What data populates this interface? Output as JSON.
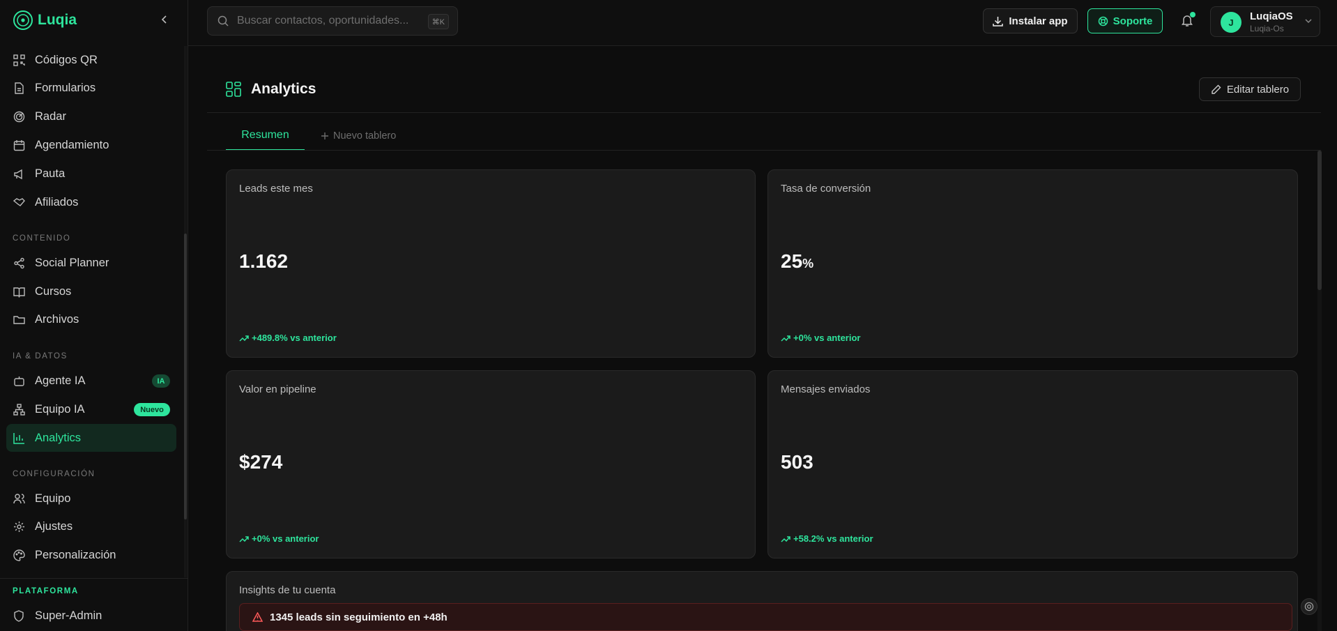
{
  "brand": {
    "name": "Luqia",
    "accent": "#2ee59d"
  },
  "sidebar": {
    "items_top": [
      {
        "label": "Códigos QR",
        "icon": "qr-icon"
      },
      {
        "label": "Formularios",
        "icon": "document-icon"
      },
      {
        "label": "Radar",
        "icon": "radar-icon"
      },
      {
        "label": "Agendamiento",
        "icon": "calendar-icon"
      },
      {
        "label": "Pauta",
        "icon": "megaphone-icon"
      },
      {
        "label": "Afiliados",
        "icon": "handshake-icon"
      }
    ],
    "sections": {
      "contenido": "CONTENIDO",
      "ia_datos": "IA & DATOS",
      "configuracion": "CONFIGURACIÓN",
      "plataforma": "PLATAFORMA"
    },
    "items_contenido": [
      {
        "label": "Social Planner",
        "icon": "share-icon"
      },
      {
        "label": "Cursos",
        "icon": "book-icon"
      },
      {
        "label": "Archivos",
        "icon": "folder-icon"
      }
    ],
    "items_ia": [
      {
        "label": "Agente IA",
        "icon": "bot-icon",
        "badge": "IA"
      },
      {
        "label": "Equipo IA",
        "icon": "network-icon",
        "badge": "Nuevo"
      },
      {
        "label": "Analytics",
        "icon": "bar-chart-icon",
        "active": true
      }
    ],
    "items_config": [
      {
        "label": "Equipo",
        "icon": "users-icon"
      },
      {
        "label": "Ajustes",
        "icon": "gear-icon"
      },
      {
        "label": "Personalización",
        "icon": "palette-icon"
      }
    ],
    "items_plataforma": [
      {
        "label": "Super-Admin",
        "icon": "shield-icon"
      }
    ]
  },
  "topbar": {
    "search_placeholder": "Buscar contactos, oportunidades...",
    "search_shortcut": "⌘K",
    "install_label": "Instalar app",
    "support_label": "Soporte",
    "user": {
      "initial": "J",
      "name": "LuqiaOS",
      "sub": "Luqia-Os"
    }
  },
  "main": {
    "title": "Analytics",
    "edit_label": "Editar tablero",
    "tabs": [
      {
        "label": "Resumen"
      },
      {
        "label": "Nuevo tablero"
      }
    ],
    "cards": [
      {
        "title": "Leads este mes",
        "value": "1.162",
        "unit": "",
        "trend": "+489.8% vs anterior"
      },
      {
        "title": "Tasa de conversión",
        "value": "25",
        "unit": "%",
        "trend": "+0% vs anterior"
      },
      {
        "title": "Valor en pipeline",
        "value": "$274",
        "unit": "",
        "trend": "+0% vs anterior"
      },
      {
        "title": "Mensajes enviados",
        "value": "503",
        "unit": "",
        "trend": "+58.2% vs anterior"
      }
    ],
    "insights": {
      "title": "Insights de tu cuenta",
      "alert": "1345 leads sin seguimiento en +48h"
    }
  }
}
